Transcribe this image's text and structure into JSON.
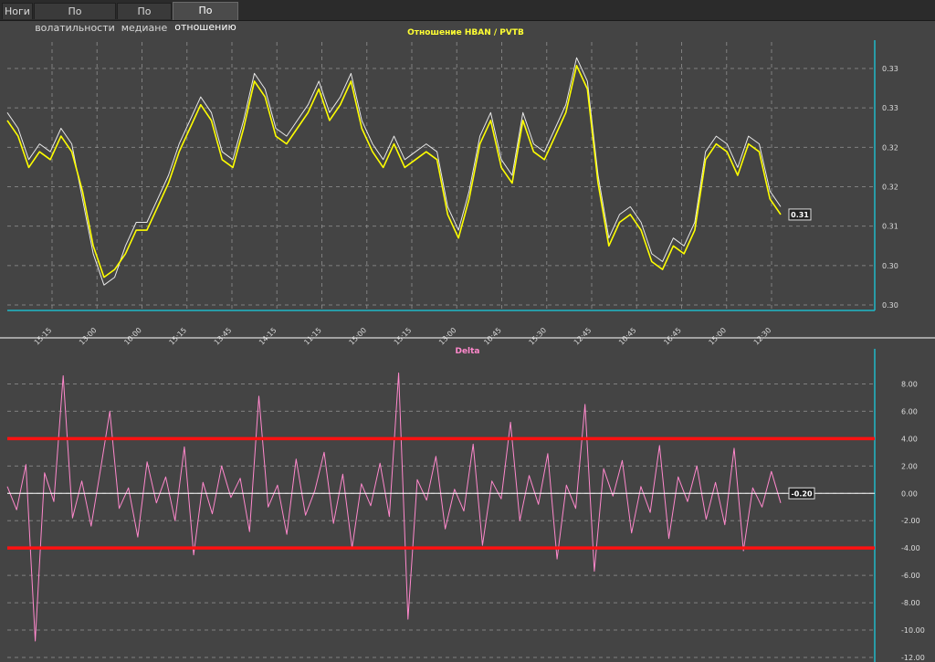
{
  "tabs": [
    {
      "label": "Ноги",
      "active": false
    },
    {
      "label": "По волатильности",
      "active": false
    },
    {
      "label": "По медиане",
      "active": false
    },
    {
      "label": "По отношению",
      "active": true
    }
  ],
  "chart_data": [
    {
      "type": "line",
      "title": "Отношение   HBAN / PVTB",
      "title_color": "#ffff33",
      "series": [
        {
          "color": "#ffff00",
          "values": [
            0.322,
            0.32,
            0.316,
            0.318,
            0.317,
            0.32,
            0.318,
            0.313,
            0.306,
            0.302,
            0.303,
            0.305,
            0.308,
            0.308,
            0.311,
            0.314,
            0.318,
            0.321,
            0.324,
            0.322,
            0.317,
            0.316,
            0.321,
            0.327,
            0.325,
            0.32,
            0.319,
            0.321,
            0.323,
            0.326,
            0.322,
            0.324,
            0.327,
            0.321,
            0.318,
            0.316,
            0.319,
            0.316,
            0.317,
            0.318,
            0.317,
            0.31,
            0.307,
            0.312,
            0.319,
            0.322,
            0.316,
            0.314,
            0.322,
            0.318,
            0.317,
            0.32,
            0.323,
            0.329,
            0.326,
            0.314,
            0.306,
            0.309,
            0.31,
            0.308,
            0.304,
            0.303,
            0.306,
            0.305,
            0.308,
            0.317,
            0.319,
            0.318,
            0.315,
            0.319,
            0.318,
            0.312,
            0.31
          ]
        },
        {
          "color": "#e8e8e8",
          "values": [
            0.323,
            0.321,
            0.317,
            0.319,
            0.318,
            0.321,
            0.319,
            0.312,
            0.305,
            0.301,
            0.302,
            0.306,
            0.309,
            0.309,
            0.312,
            0.315,
            0.319,
            0.322,
            0.325,
            0.323,
            0.318,
            0.317,
            0.322,
            0.328,
            0.326,
            0.321,
            0.32,
            0.322,
            0.324,
            0.327,
            0.323,
            0.325,
            0.328,
            0.322,
            0.319,
            0.317,
            0.32,
            0.317,
            0.318,
            0.319,
            0.318,
            0.311,
            0.308,
            0.313,
            0.32,
            0.323,
            0.317,
            0.315,
            0.323,
            0.319,
            0.318,
            0.321,
            0.324,
            0.33,
            0.327,
            0.315,
            0.307,
            0.31,
            0.311,
            0.309,
            0.305,
            0.304,
            0.307,
            0.306,
            0.309,
            0.318,
            0.32,
            0.319,
            0.316,
            0.32,
            0.319,
            0.313,
            0.311
          ]
        }
      ],
      "x_tick_labels": [
        "15:15",
        "13:00",
        "10:00",
        "15:15",
        "13:45",
        "14:15",
        "11:15",
        "15:00",
        "15:15",
        "13:00",
        "10:45",
        "15:30",
        "12:45",
        "10:45",
        "16:45",
        "15:00",
        "12:30"
      ],
      "y_tick_labels": [
        "0.33",
        "0.33",
        "0.32",
        "0.32",
        "0.31",
        "0.30",
        "0.30"
      ],
      "ylim": [
        0.298,
        0.332
      ],
      "last_value_label": "0.31",
      "grid": true
    },
    {
      "type": "line",
      "title": "Delta",
      "title_color": "#ff88cc",
      "series": [
        {
          "color": "#ff88cc",
          "values": [
            0.5,
            -1.2,
            2.1,
            -10.8,
            1.5,
            -0.6,
            8.6,
            -1.8,
            0.9,
            -2.4,
            1.7,
            6.0,
            -1.1,
            0.4,
            -3.2,
            2.3,
            -0.7,
            1.2,
            -2.0,
            3.4,
            -4.5,
            0.8,
            -1.5,
            2.0,
            -0.3,
            1.1,
            -2.8,
            7.1,
            -1.0,
            0.6,
            -3.0,
            2.5,
            -1.6,
            0.2,
            3.0,
            -2.2,
            1.4,
            -4.0,
            0.7,
            -0.9,
            2.2,
            -1.7,
            8.8,
            -9.2,
            1.0,
            -0.5,
            2.7,
            -2.6,
            0.3,
            -1.3,
            3.6,
            -3.8,
            0.9,
            -0.4,
            5.2,
            -2.0,
            1.3,
            -0.8,
            2.9,
            -4.8,
            0.6,
            -1.1,
            6.5,
            -5.7,
            1.8,
            -0.2,
            2.4,
            -2.9,
            0.5,
            -1.4,
            3.5,
            -3.3,
            1.2,
            -0.6,
            2.0,
            -1.9,
            0.8,
            -2.3,
            3.3,
            -4.2,
            0.4,
            -1.0,
            1.6,
            -0.7
          ]
        }
      ],
      "y_tick_labels": [
        "8.00",
        "6.00",
        "4.00",
        "2.00",
        "0.00",
        "-2.00",
        "-4.00",
        "-6.00",
        "-8.00",
        "-10.00",
        "-12.00"
      ],
      "ylim": [
        -12,
        9.5
      ],
      "thresholds": [
        {
          "value": 4,
          "color": "#ff1111"
        },
        {
          "value": -4,
          "color": "#ff1111"
        }
      ],
      "zero_line_color": "#ffffff",
      "last_value_label": "-0.20",
      "grid": true
    }
  ]
}
